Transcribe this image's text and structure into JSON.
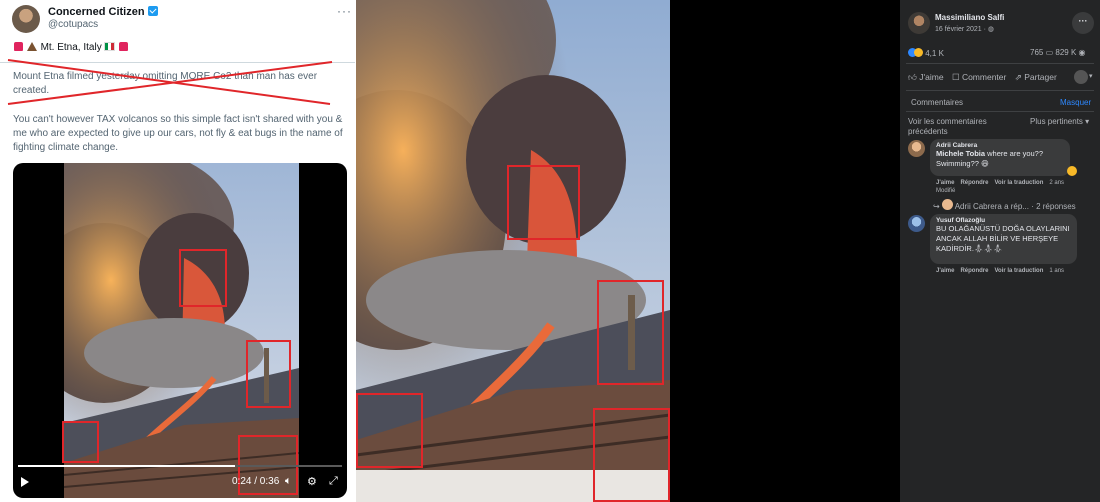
{
  "tweet": {
    "display_name": "Concerned Citizen",
    "handle": "@cotupacs",
    "more": "···",
    "location_line": "Mt. Etna, Italy",
    "text_struck": "Mount Etna filmed yesterday omitting MORE Co2 than man has ever created.",
    "text_body": "You can't however TAX volcanos so this simple fact isn't shared with you & me who are expected to give up our cars, not fly & eat bugs in the name of fighting climate change.",
    "video": {
      "time": "0:24 / 0:36",
      "progress": 0.67,
      "icons": [
        "play-icon",
        "volume-icon",
        "settings-icon",
        "fullscreen-icon"
      ]
    },
    "colors": {
      "verified": "#1d9bf0",
      "cross": "#e0262a"
    }
  },
  "facebook": {
    "author": "Massimiliano Salfi",
    "date": "16 février 2021 · ",
    "more_button": "···",
    "reaction_count": "4,1 K",
    "comment_count": "765",
    "view_count": "829 K",
    "actions": {
      "like": "J'aime",
      "comment": "Commenter",
      "share": "Partager"
    },
    "comments_header": "Commentaires",
    "hide": "Masquer",
    "see_previous": "Voir les commentaires précédents",
    "sort": "Plus pertinents",
    "comments": [
      {
        "author": "Adrii Cabrera",
        "mention": "Michele Tobia",
        "text": "where are you?? Swimming??",
        "like": "J'aime",
        "reply": "Répondre",
        "translate": "Voir la traduction",
        "age": "2 ans",
        "edited": "Modifié"
      },
      {
        "author": "Yusuf Oflazoğlu",
        "text": "BU OLAĞANÜSTÜ DOĞA OLAYLARINI ANCAK ALLAH BİLİR VE HERŞEYE KADİRDİR.",
        "like": "J'aime",
        "reply": "Répondre",
        "translate": "Voir la traduction",
        "age": "1 ans"
      }
    ],
    "reply_summary": "Adrii Cabrera a rép... · 2 réponses",
    "colors": {
      "background": "#242526",
      "link": "#2d88ff"
    }
  },
  "annotation": {
    "box_color": "#e0262a"
  }
}
